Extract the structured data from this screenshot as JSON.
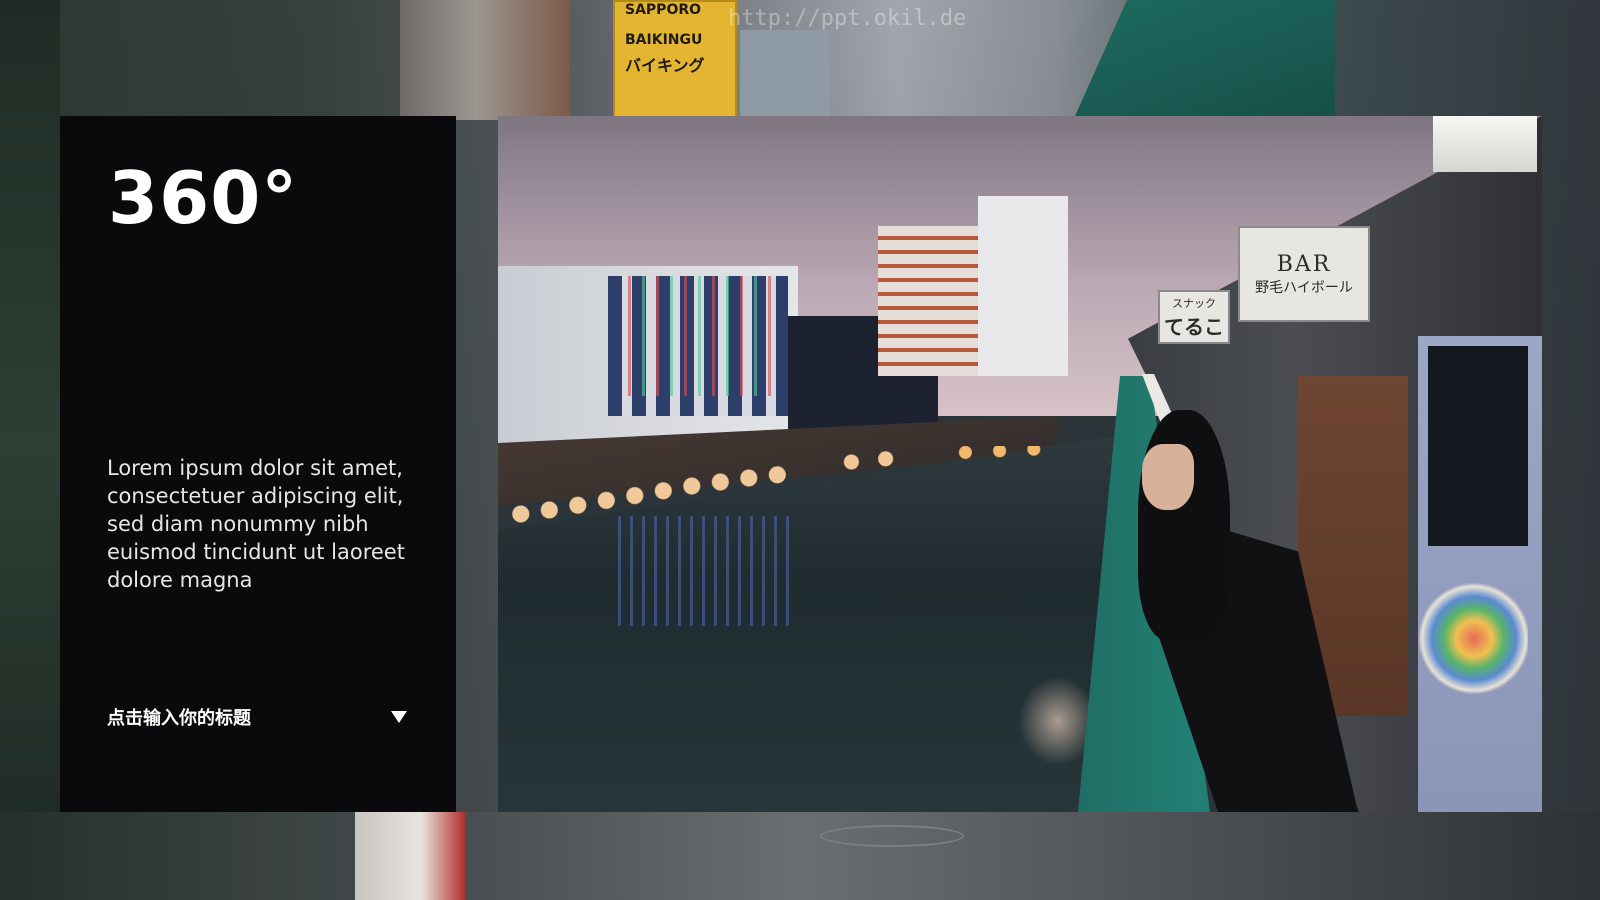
{
  "slide": {
    "headline": "360°",
    "body": "Lorem ipsum dolor sit amet, consectetuer adipiscing elit, sed diam nonummy nibh euismod tincidunt ut laoreet dolore magna",
    "subtitle": "点击输入你的标题",
    "dropdown_icon": "triangle-down"
  },
  "background": {
    "watermark": "http://ppt.okil.de",
    "sign_yellow_top": "SAPPORO",
    "sign_yellow_mid": "BAIKINGU",
    "sign_yellow_jp": "バイキング"
  },
  "photo": {
    "sign_bar_en": "BAR",
    "sign_bar_jp": "野毛ハイボール",
    "sign_small_top": "スナック",
    "sign_small_main": "てるこ"
  },
  "colors": {
    "panel_bg": "#0a0a0c",
    "panel_text": "#ffffff",
    "railing": "#1f6e64"
  }
}
